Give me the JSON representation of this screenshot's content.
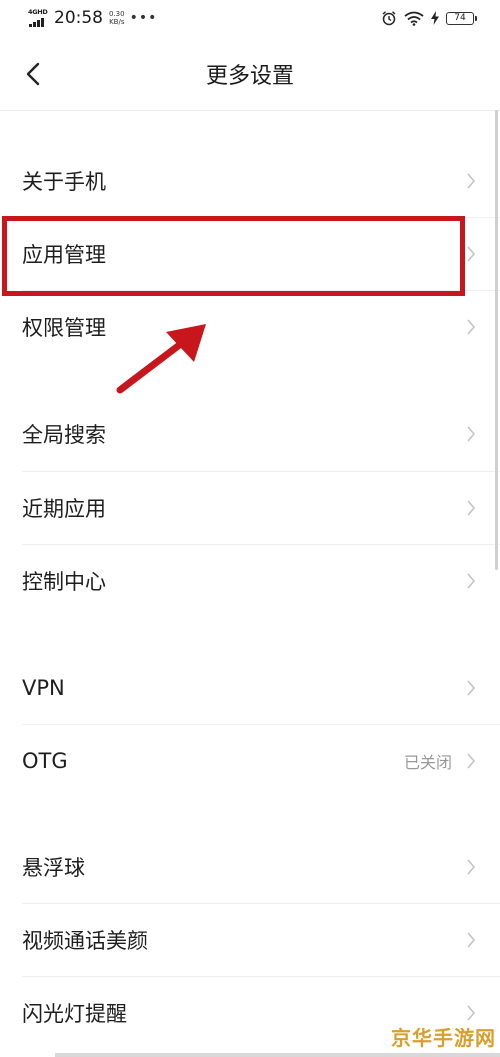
{
  "status_bar": {
    "network": "4GHD",
    "time": "20:58",
    "speed_value": "0.30",
    "speed_unit": "KB/s",
    "battery": "74"
  },
  "header": {
    "title": "更多设置"
  },
  "items": [
    {
      "label": "关于手机"
    },
    {
      "label": "应用管理"
    },
    {
      "label": "权限管理"
    },
    {
      "label": "全局搜索"
    },
    {
      "label": "近期应用"
    },
    {
      "label": "控制中心"
    },
    {
      "label": "VPN"
    },
    {
      "label": "OTG",
      "value": "已关闭"
    },
    {
      "label": "悬浮球"
    },
    {
      "label": "视频通话美颜"
    },
    {
      "label": "闪光灯提醒"
    }
  ],
  "annotation": {
    "highlight_color": "#c8161d"
  },
  "watermark": "京华手游网"
}
